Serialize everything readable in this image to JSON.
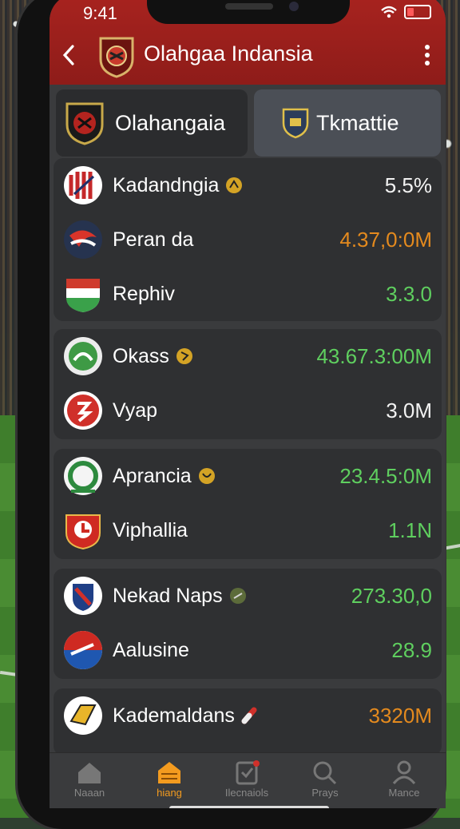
{
  "status": {
    "time": "9:41"
  },
  "header": {
    "title": "Olahgaa Indansia"
  },
  "tabs": [
    {
      "label": "Olahangaia"
    },
    {
      "label": "Tkmattie"
    }
  ],
  "groups": [
    {
      "rows": [
        {
          "name": "Kadandngia",
          "value": "5.5%",
          "value_color": "white",
          "badge": "ball-icon"
        },
        {
          "name": "Peran da",
          "value": "4.37,0:0M",
          "value_color": "orange"
        },
        {
          "name": "Rephiv",
          "value": "3.3.0",
          "value_color": "green"
        }
      ]
    },
    {
      "rows": [
        {
          "name": "Okass",
          "value": "43.67.3:00M",
          "value_color": "green",
          "badge": "ball-icon"
        },
        {
          "name": "Vyap",
          "value": "3.0M",
          "value_color": "white",
          "name_color": "red"
        }
      ]
    },
    {
      "rows": [
        {
          "name": "Aprancia",
          "value": "23.4.5:0M",
          "value_color": "green",
          "badge": "ball-icon"
        },
        {
          "name": "Viphallia",
          "value": "1.1N",
          "value_color": "green",
          "name_color": "red"
        }
      ]
    },
    {
      "rows": [
        {
          "name": "Nekad Naps",
          "value": "273.30,0",
          "value_color": "green",
          "badge": "ball-icon"
        },
        {
          "name": "Aalusine",
          "value": "28.9",
          "value_color": "green"
        }
      ]
    },
    {
      "rows": [
        {
          "name": "Kademaldans",
          "value": "3320M",
          "value_color": "orange",
          "badge": "pill-icon"
        }
      ]
    }
  ],
  "bottom_nav": [
    {
      "label": "Naaan",
      "icon": "home-icon"
    },
    {
      "label": "hiang",
      "icon": "stadium-icon",
      "active": true
    },
    {
      "label": "Ilecnaiols",
      "icon": "clipboard-icon"
    },
    {
      "label": "Prays",
      "icon": "search-icon"
    },
    {
      "label": "Mance",
      "icon": "user-icon"
    }
  ],
  "colors": {
    "header": "#a8231f",
    "card": "#2f3032",
    "accent": "#f39b1f",
    "positive": "#5fcf5f",
    "warning": "#e48a1e",
    "negative": "#e5483a"
  }
}
